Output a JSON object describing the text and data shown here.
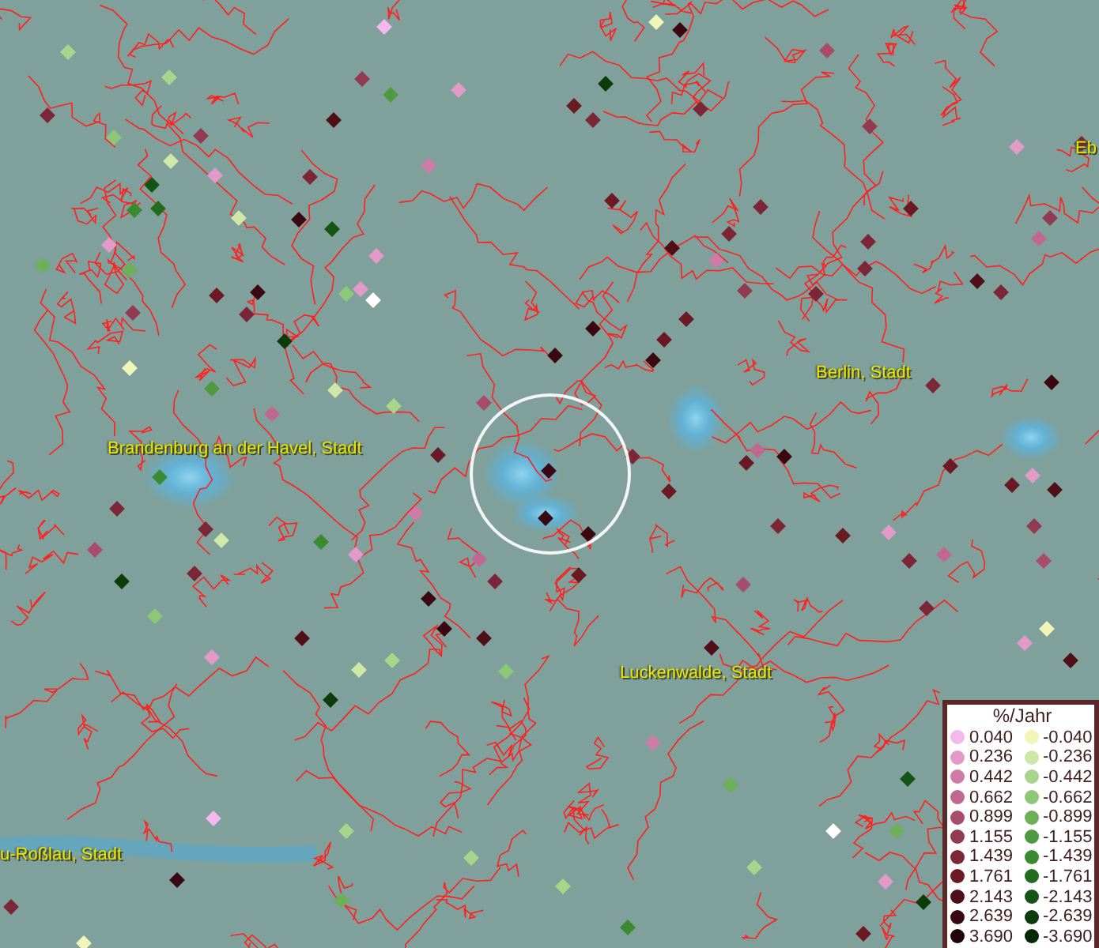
{
  "map": {
    "place_labels": [
      {
        "text": "Eb"
      },
      {
        "text": "Berlin, Stadt"
      },
      {
        "text": "Brandenburg an der Havel, Stadt"
      },
      {
        "text": "Luckenwalde, Stadt"
      },
      {
        "text": "u-Roßlau, Stadt"
      }
    ]
  },
  "legend": {
    "title": "%/Jahr",
    "positive": [
      {
        "value": "0.040",
        "color": "#f4b8ec"
      },
      {
        "value": "0.236",
        "color": "#e39ac8"
      },
      {
        "value": "0.442",
        "color": "#cf7ba7"
      },
      {
        "value": "0.662",
        "color": "#c0688f"
      },
      {
        "value": "0.899",
        "color": "#a84c6c"
      },
      {
        "value": "1.155",
        "color": "#913a52"
      },
      {
        "value": "1.439",
        "color": "#7b2738"
      },
      {
        "value": "1.761",
        "color": "#6b1a24"
      },
      {
        "value": "2.143",
        "color": "#4e0f18"
      },
      {
        "value": "2.639",
        "color": "#3a0810"
      },
      {
        "value": "3.690",
        "color": "#200308"
      }
    ],
    "negative": [
      {
        "value": "-0.040",
        "color": "#f0f5b8"
      },
      {
        "value": "-0.236",
        "color": "#cfe8a8"
      },
      {
        "value": "-0.442",
        "color": "#a8d48c"
      },
      {
        "value": "-0.662",
        "color": "#8cc878"
      },
      {
        "value": "-0.899",
        "color": "#6cb058"
      },
      {
        "value": "-1.155",
        "color": "#4f9a40"
      },
      {
        "value": "-1.439",
        "color": "#3a8a30"
      },
      {
        "value": "-1.761",
        "color": "#226c1e"
      },
      {
        "value": "-2.143",
        "color": "#145414"
      },
      {
        "value": "-2.639",
        "color": "#0c3c0c"
      },
      {
        "value": "-3.690",
        "color": "#062806"
      }
    ]
  }
}
